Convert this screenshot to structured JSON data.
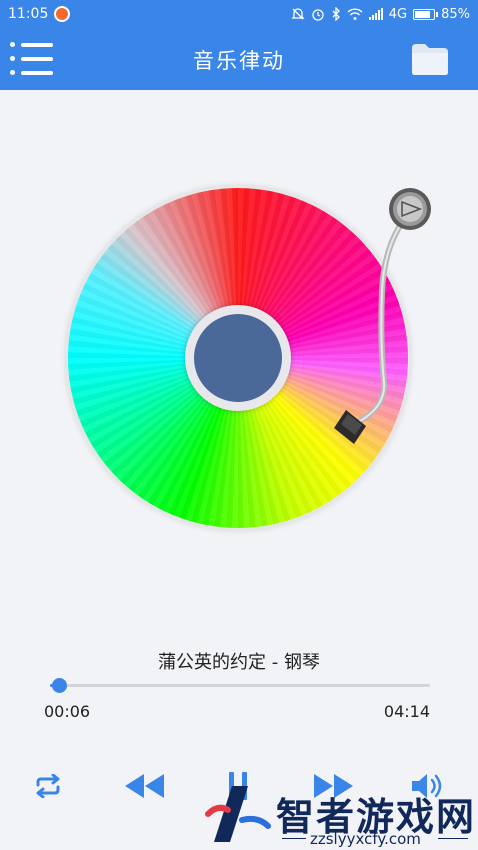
{
  "status_bar": {
    "time": "11:05",
    "network": "4G",
    "battery": "85%",
    "battery_level": 0.85
  },
  "app_bar": {
    "title": "音乐律动",
    "menu_icon": "menu-list-icon",
    "folder_icon": "folder-icon"
  },
  "player": {
    "song_title": "蒲公英的约定 - 钢琴",
    "current_time": "00:06",
    "total_time": "04:14",
    "progress": 0.024
  },
  "controls": {
    "repeat_icon": "repeat-icon",
    "previous_icon": "rewind-icon",
    "play_pause_icon": "pause-icon",
    "next_icon": "fast-forward-icon",
    "volume_icon": "volume-icon"
  },
  "watermark": {
    "text": "智者游戏网",
    "url": "zzslyyxcfy.com"
  },
  "colors": {
    "accent": "#3a86e8",
    "disc_center": "#4a6898",
    "background": "#f2f3f7"
  }
}
